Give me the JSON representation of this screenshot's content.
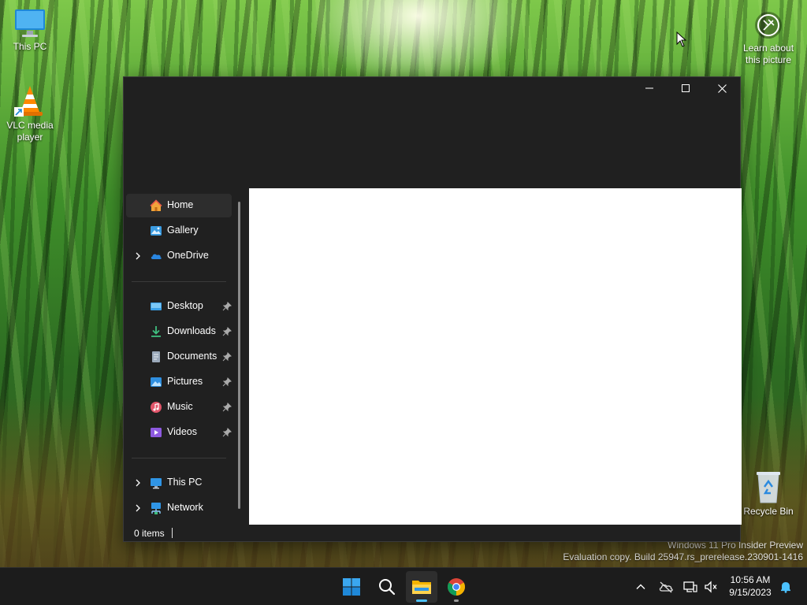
{
  "desktop": {
    "icons": {
      "this_pc": "This PC",
      "vlc": "VLC media player",
      "recycle_bin": "Recycle Bin",
      "learn": "Learn about this picture"
    },
    "watermark": {
      "line1": "Windows 11 Pro Insider Preview",
      "line2": "Evaluation copy. Build 25947.rs_prerelease.230901-1416"
    }
  },
  "explorer": {
    "nav": {
      "home": "Home",
      "gallery": "Gallery",
      "onedrive": "OneDrive",
      "desktop": "Desktop",
      "downloads": "Downloads",
      "documents": "Documents",
      "pictures": "Pictures",
      "music": "Music",
      "videos": "Videos",
      "this_pc": "This PC",
      "network": "Network"
    },
    "status": {
      "item_count": "0 items"
    }
  },
  "taskbar": {
    "clock": {
      "time": "10:56 AM",
      "date": "9/15/2023"
    }
  },
  "colors": {
    "accent": "#4cc2ff",
    "window_bg": "#202020",
    "taskbar_bg": "#1c1c1c"
  }
}
